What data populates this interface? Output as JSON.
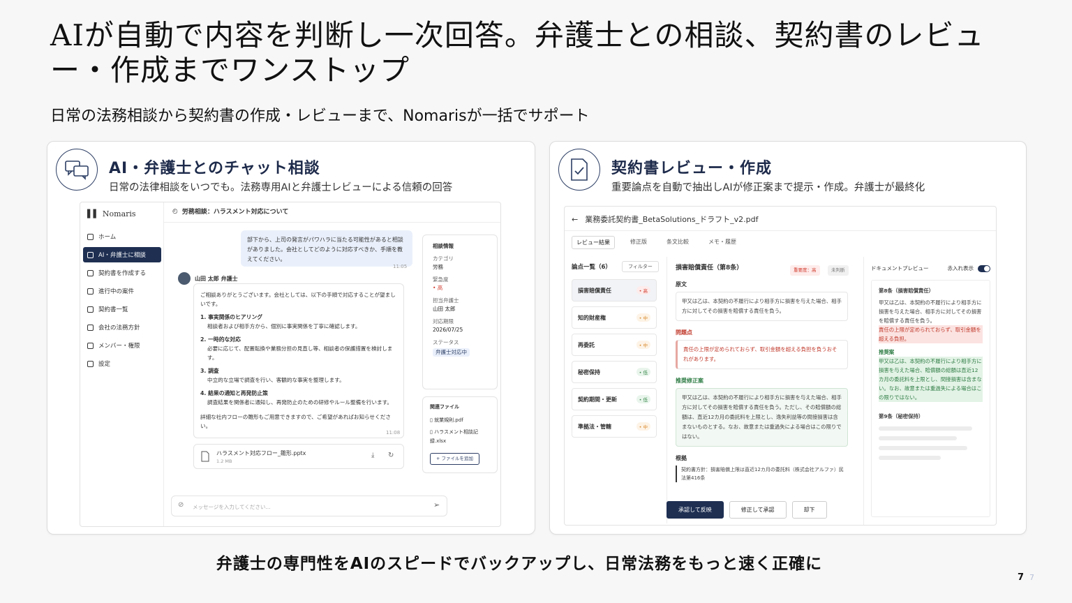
{
  "slide": {
    "title": "AIが自動で内容を判断し一次回答。弁護士との相談、契約書のレビュー・作成までワンストップ",
    "subtitle": "日常の法務相談から契約書の作成・レビューまで、Nomarisが一括でサポート",
    "bottom_message": "弁護士の専門性をAIのスピードでバックアップし、日常法務をもっと速く正確に",
    "page_number": "7",
    "page_number_ghost": "7"
  },
  "chat_card": {
    "icon": "chat-bubbles-icon",
    "title": "AI・弁護士とのチャット相談",
    "desc": "日常の法律相談をいつでも。法務専用AIと弁護士レビューによる信頼の回答",
    "app": {
      "logo": "Nomaris",
      "nav": [
        "ホーム",
        "AI・弁護士に相談",
        "契約書を作成する",
        "進行中の案件",
        "契約書一覧",
        "会社の法務方針",
        "メンバー・権限",
        "設定"
      ],
      "thread_title": "労務相談：ハラスメント対応について",
      "user_message": "部下から、上司の発言がパワハラに当たる可能性があると相談がありました。会社としてどのように対応すべきか、手順を教えてください。",
      "user_time": "11:05",
      "lawyer_name": "山田 太郎 弁護士",
      "reply_intro": "ご相談ありがとうございます。会社としては、以下の手順で対応することが望ましいです。",
      "steps": [
        {
          "title": "1. 事実関係のヒアリング",
          "body": "相談者および相手方から、個別に事実関係を丁寧に確認します。"
        },
        {
          "title": "2. 一時的な対応",
          "body": "必要に応じて、配置転換や業務分担の見直し等、相談者の保護措置を検討します。"
        },
        {
          "title": "3. 調査",
          "body": "中立的な立場で調査を行い、客観的な事実を整理します。"
        },
        {
          "title": "4. 結果の通知と再発防止策",
          "body": "調査結果を関係者に通知し、再発防止のための研修やルール整備を行います。"
        }
      ],
      "reply_outro": "詳細な社内フローの雛形もご用意できますので、ご希望があればお知らせください。",
      "reply_time": "11:08",
      "attachment_name": "ハラスメント対応フロー_雛形.pptx",
      "attachment_size": "1.2 MB",
      "input_placeholder": "メッセージを入力してください...",
      "info": {
        "heading": "相談情報",
        "category_label": "カテゴリ",
        "category": "労務",
        "urgency_label": "緊急度",
        "urgency": "• 高",
        "lawyer_label": "担当弁護士",
        "lawyer": "山田 太郎",
        "deadline_label": "対応期限",
        "deadline": "2026/07/25",
        "status_label": "ステータス",
        "status": "弁護士対応中"
      },
      "files": {
        "heading": "関連ファイル",
        "items": [
          "就業規則.pdf",
          "ハラスメント相談記録.xlsx"
        ],
        "add_label": "+ ファイルを追加"
      }
    }
  },
  "review_card": {
    "icon": "document-check-icon",
    "title": "契約書レビュー・作成",
    "desc": "重要論点を自動で抽出しAIが修正案まで提示・作成。弁護士が最終化",
    "app": {
      "file_title": "業務委託契約書_BetaSolutions_ドラフト_v2.pdf",
      "tabs": [
        "レビュー結果",
        "修正版",
        "条文比較",
        "メモ・履歴"
      ],
      "issues_title": "論点一覧（6）",
      "filter_label": "フィルター",
      "issues": [
        {
          "name": "損害賠償責任",
          "sev": "• 高",
          "level": "high"
        },
        {
          "name": "知的財産権",
          "sev": "• 中",
          "level": "mid"
        },
        {
          "name": "再委託",
          "sev": "• 中",
          "level": "mid"
        },
        {
          "name": "秘密保持",
          "sev": "• 低",
          "level": "low"
        },
        {
          "name": "契約期間・更新",
          "sev": "• 低",
          "level": "low"
        },
        {
          "name": "準拠法・管轄",
          "sev": "• 中",
          "level": "mid"
        }
      ],
      "detail_title": "損害賠償責任（第8条）",
      "tag_importance": "重要度：高",
      "tag_status": "未判断",
      "original_label": "原文",
      "original_text": "甲又は乙は、本契約の不履行により相手方に損害を与えた場合、相手方に対してその損害を賠償する責任を負う。",
      "problem_label": "問題点",
      "problem_text": "責任の上限が定められておらず、取引金額を超える負担を負うおそれがあります。",
      "fix_label": "推奨修正案",
      "fix_text": "甲又は乙は、本契約の不履行により相手方に損害を与えた場合、相手方に対してその損害を賠償する責任を負う。ただし、その賠償額の総額は、直近12カ月の委託料を上限とし、逸失利益等の間接損害は含まないものとする。なお、故意または重過失による場合はこの限りではない。",
      "basis_label": "根拠",
      "basis_text": "契約書方針：損害賠償上限は直近12カ月の委託料（株式会社アルファ）民法第416条",
      "btn_approve_reflect": "承認して反映",
      "btn_edit_approve": "修正して承認",
      "btn_reject": "却下",
      "preview_label": "ドキュメントプレビュー",
      "redline_label": "赤入れ表示",
      "preview_art8": "第8条（損害賠償責任）",
      "preview_body1": "甲又は乙は、本契約の不履行により相手方に損害を与えた場合、相手方に対してその損害を賠償する責任を負う。",
      "preview_red": "責任の上限が定められておらず、取引金額を超える負担。",
      "preview_fix_label": "推奨案",
      "preview_green": "甲又は乙は、本契約の不履行により相手方に損害を与えた場合、賠償額の総額は直近12カ月の委託料を上限とし、間接損害は含まない。なお、故意または重過失による場合はこの限りではない。",
      "preview_art9": "第9条（秘密保持）"
    }
  }
}
